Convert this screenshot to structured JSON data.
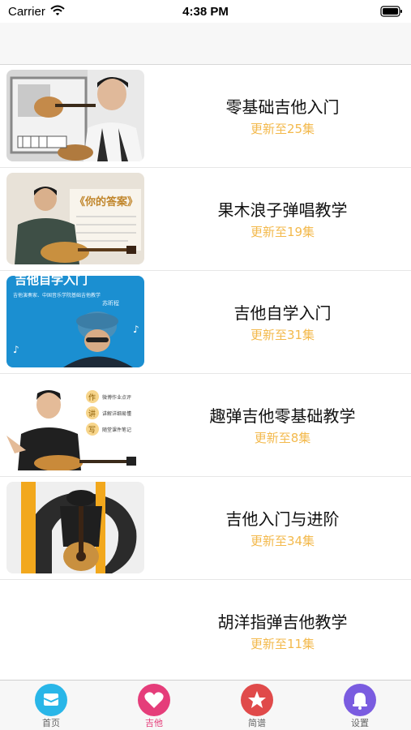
{
  "status_bar": {
    "carrier": "Carrier",
    "time": "4:38 PM"
  },
  "courses": [
    {
      "title": "零基础吉他入门",
      "update": "更新至25集"
    },
    {
      "title": "果木浪子弹唱教学",
      "update": "更新至19集"
    },
    {
      "title": "吉他自学入门",
      "update": "更新至31集"
    },
    {
      "title": "趣弹吉他零基础教学",
      "update": "更新至8集"
    },
    {
      "title": "吉他入门与进阶",
      "update": "更新至34集"
    },
    {
      "title": "胡洋指弹吉他教学",
      "update": "更新至11集"
    }
  ],
  "thumbnail_text": {
    "answer_title": "《你的答案》",
    "self_study_banner": "吉他自学入门",
    "self_study_sub": "吉他演奏家、中国音乐学院基础吉他教学",
    "self_study_name": "苏昕程",
    "badge_zuo": "作",
    "badge_jiang": "讲",
    "badge_xie": "写",
    "badge_zuo_text": "微博作业点评",
    "badge_jiang_text": "讲解详细易懂",
    "badge_xie_text": "随堂课件笔记"
  },
  "tabs": [
    {
      "label": "首页",
      "icon": "home-icon",
      "color": "#29b6e8",
      "active": false
    },
    {
      "label": "吉他",
      "icon": "heart-icon",
      "color": "#e53d7a",
      "active": true
    },
    {
      "label": "简谱",
      "icon": "star-icon",
      "color": "#e04a4a",
      "active": false
    },
    {
      "label": "设置",
      "icon": "bell-icon",
      "color": "#7a5ce0",
      "active": false
    }
  ]
}
